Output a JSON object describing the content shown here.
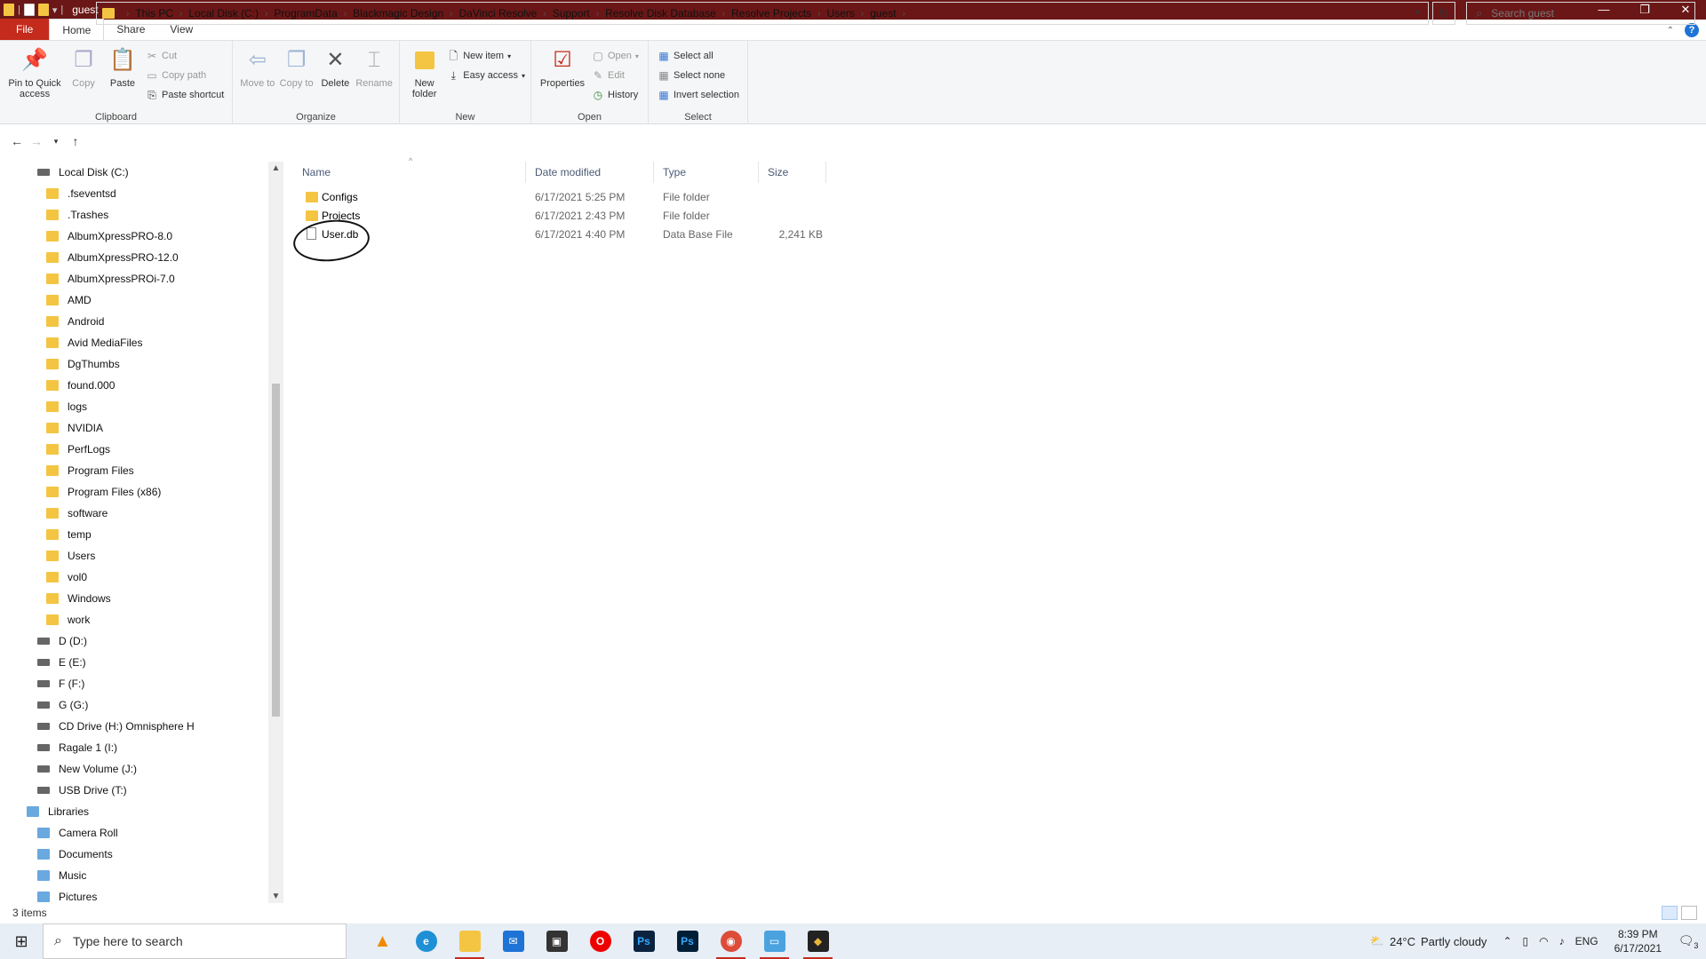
{
  "window": {
    "title": "guest"
  },
  "ribbon_tabs": [
    "File",
    "Home",
    "Share",
    "View"
  ],
  "ribbon": {
    "clipboard": {
      "label": "Clipboard",
      "pin": "Pin to Quick access",
      "copy": "Copy",
      "paste": "Paste",
      "cut": "Cut",
      "copy_path": "Copy path",
      "paste_shortcut": "Paste shortcut"
    },
    "organize": {
      "label": "Organize",
      "move_to": "Move to",
      "copy_to": "Copy to",
      "delete": "Delete",
      "rename": "Rename"
    },
    "new": {
      "label": "New",
      "new_folder": "New folder",
      "new_item": "New item",
      "easy_access": "Easy access"
    },
    "open": {
      "label": "Open",
      "properties": "Properties",
      "open": "Open",
      "edit": "Edit",
      "history": "History"
    },
    "select": {
      "label": "Select",
      "select_all": "Select all",
      "select_none": "Select none",
      "invert": "Invert selection"
    }
  },
  "breadcrumb": [
    "This PC",
    "Local Disk (C:)",
    "ProgramData",
    "Blackmagic Design",
    "DaVinci Resolve",
    "Support",
    "Resolve Disk Database",
    "Resolve Projects",
    "Users",
    "guest"
  ],
  "search": {
    "placeholder": "Search guest"
  },
  "nav": {
    "items": [
      {
        "label": "Local Disk (C:)",
        "type": "drive",
        "indent": 1
      },
      {
        "label": ".fseventsd",
        "type": "folder",
        "indent": 2
      },
      {
        "label": ".Trashes",
        "type": "folder",
        "indent": 2
      },
      {
        "label": "AlbumXpressPRO-8.0",
        "type": "folder",
        "indent": 2
      },
      {
        "label": "AlbumXpressPRO-12.0",
        "type": "folder",
        "indent": 2
      },
      {
        "label": "AlbumXpressPROi-7.0",
        "type": "folder",
        "indent": 2
      },
      {
        "label": "AMD",
        "type": "folder",
        "indent": 2
      },
      {
        "label": "Android",
        "type": "folder",
        "indent": 2
      },
      {
        "label": "Avid MediaFiles",
        "type": "folder",
        "indent": 2
      },
      {
        "label": "DgThumbs",
        "type": "folder",
        "indent": 2
      },
      {
        "label": "found.000",
        "type": "folder",
        "indent": 2
      },
      {
        "label": "logs",
        "type": "folder",
        "indent": 2
      },
      {
        "label": "NVIDIA",
        "type": "folder",
        "indent": 2
      },
      {
        "label": "PerfLogs",
        "type": "folder",
        "indent": 2
      },
      {
        "label": "Program Files",
        "type": "folder",
        "indent": 2
      },
      {
        "label": "Program Files (x86)",
        "type": "folder",
        "indent": 2
      },
      {
        "label": "software",
        "type": "folder",
        "indent": 2
      },
      {
        "label": "temp",
        "type": "folder",
        "indent": 2
      },
      {
        "label": "Users",
        "type": "folder",
        "indent": 2
      },
      {
        "label": "vol0",
        "type": "folder",
        "indent": 2
      },
      {
        "label": "Windows",
        "type": "folder",
        "indent": 2
      },
      {
        "label": "work",
        "type": "folder",
        "indent": 2
      },
      {
        "label": "D (D:)",
        "type": "drive",
        "indent": 1
      },
      {
        "label": "E (E:)",
        "type": "drive",
        "indent": 1
      },
      {
        "label": "F (F:)",
        "type": "drive",
        "indent": 1
      },
      {
        "label": "G (G:)",
        "type": "drive",
        "indent": 1
      },
      {
        "label": "CD Drive (H:) Omnisphere H",
        "type": "drive",
        "indent": 1
      },
      {
        "label": "Ragale 1 (I:)",
        "type": "drive",
        "indent": 1
      },
      {
        "label": "New Volume (J:)",
        "type": "drive",
        "indent": 1
      },
      {
        "label": "USB Drive (T:)",
        "type": "drive",
        "indent": 1
      },
      {
        "label": "Libraries",
        "type": "library",
        "indent": 0
      },
      {
        "label": "Camera Roll",
        "type": "library",
        "indent": 1
      },
      {
        "label": "Documents",
        "type": "library",
        "indent": 1
      },
      {
        "label": "Music",
        "type": "library",
        "indent": 1
      },
      {
        "label": "Pictures",
        "type": "library",
        "indent": 1
      }
    ]
  },
  "columns": {
    "name": "Name",
    "date": "Date modified",
    "type": "Type",
    "size": "Size"
  },
  "files": [
    {
      "name": "Configs",
      "date": "6/17/2021 5:25 PM",
      "type": "File folder",
      "size": "",
      "kind": "folder"
    },
    {
      "name": "Projects",
      "date": "6/17/2021 2:43 PM",
      "type": "File folder",
      "size": "",
      "kind": "folder"
    },
    {
      "name": "User.db",
      "date": "6/17/2021 4:40 PM",
      "type": "Data Base File",
      "size": "2,241 KB",
      "kind": "file"
    }
  ],
  "status": {
    "items": "3 items"
  },
  "taskbar": {
    "search_placeholder": "Type here to search",
    "weather_temp": "24°C",
    "weather_text": "Partly cloudy",
    "lang": "ENG",
    "time": "8:39 PM",
    "date": "6/17/2021",
    "notification_count": "3"
  },
  "colors": {
    "titlebar": "#6b1717",
    "file_tab": "#c42b1c",
    "folder": "#f4c542"
  }
}
